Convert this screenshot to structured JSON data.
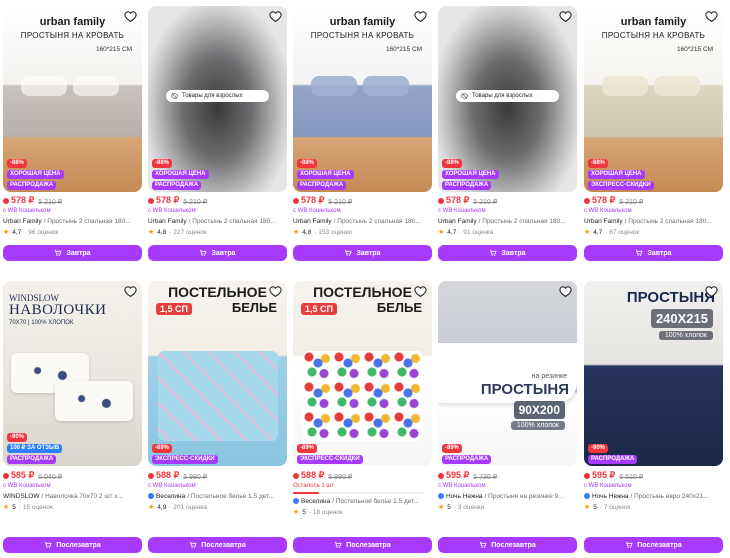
{
  "colors": {
    "accent": "#a73afd",
    "price": "#f0363c",
    "star": "#ff9900"
  },
  "adult_label": "Товары для взрослых",
  "cards": [
    {
      "image": {
        "logo": "urban family",
        "subtitle": "ПРОСТЫНЯ НА КРОВАТЬ",
        "size": "160*215 СМ"
      },
      "badges": [
        "-88%",
        "ХОРОШАЯ ЦЕНА",
        "РАСПРОДАЖА"
      ],
      "price": "578 ₽",
      "old_price": "5 210 ₽",
      "wallet": "с WB Кошельком",
      "brand": "Urban Family",
      "name": "/ Простынь 2 спальная 180...",
      "rating": "4,7",
      "reviews": "· 96 оценок",
      "button": "Завтра"
    },
    {
      "image": {},
      "badges": [
        "-88%",
        "ХОРОШАЯ ЦЕНА",
        "РАСПРОДАЖА"
      ],
      "price": "578 ₽",
      "old_price": "5 210 ₽",
      "wallet": "с WB Кошельком",
      "brand": "Urban Family",
      "name": "/ Простынь 2 спальная 180...",
      "rating": "4,8",
      "reviews": "· 227 оценок",
      "button": "Завтра"
    },
    {
      "image": {
        "logo": "urban family",
        "subtitle": "ПРОСТЫНЯ НА КРОВАТЬ",
        "size": "160*215 СМ"
      },
      "badges": [
        "-88%",
        "ХОРОШАЯ ЦЕНА",
        "РАСПРОДАЖА"
      ],
      "price": "578 ₽",
      "old_price": "5 210 ₽",
      "wallet": "с WB Кошельком",
      "brand": "Urban Family",
      "name": "/ Простынь 2 спальная 180...",
      "rating": "4,8",
      "reviews": "· 153 оценки",
      "button": "Завтра"
    },
    {
      "image": {},
      "badges": [
        "-88%",
        "ХОРОШАЯ ЦЕНА",
        "РАСПРОДАЖА"
      ],
      "price": "578 ₽",
      "old_price": "5 210 ₽",
      "wallet": "с WB Кошельком",
      "brand": "Urban Family",
      "name": "/ Простынь 2 спальная 180...",
      "rating": "4,7",
      "reviews": "· 91 оценка",
      "button": "Завтра"
    },
    {
      "image": {
        "logo": "urban family",
        "subtitle": "ПРОСТЫНЯ НА КРОВАТЬ",
        "size": "160*215 СМ"
      },
      "badges": [
        "-88%",
        "ХОРОШАЯ ЦЕНА",
        "ЭКСПРЕСС-СКИДКИ"
      ],
      "price": "578 ₽",
      "old_price": "5 210 ₽",
      "wallet": "с WB Кошельком",
      "brand": "Urban Family",
      "name": "/ Простынь 2 спальная 180...",
      "rating": "4,7",
      "reviews": "· 67 оценок",
      "button": "Завтра"
    },
    {
      "image": {
        "brand": "WINDSLOW",
        "title": "НАВОЛОЧКИ",
        "sub": "70Х70 | 100% ХЛОПОК"
      },
      "badges": [
        "-90%",
        "100 ₽ ЗА ОТЗЫВ",
        "РАСПРОДАЖА"
      ],
      "price": "585 ₽",
      "old_price": "6 040 ₽",
      "wallet": "с WB Кошельком",
      "brand": "WINDSLOW",
      "name": "/ Наволочка 70х70 2 шт х...",
      "rating": "5",
      "reviews": "· 15 оценок",
      "button": "Послезавтра"
    },
    {
      "image": {
        "title": "ПОСТЕЛЬНОЕ",
        "title2": "БЕЛЬЕ",
        "sp": "1,5 СП"
      },
      "badges": [
        "-89%",
        "ЭКСПРЕСС-СКИДКИ"
      ],
      "price": "588 ₽",
      "old_price": "5 990 ₽",
      "wallet": "с WB Кошельком",
      "brand": "Веселина",
      "name": "/ Постельное белье 1.5 дет...",
      "rating": "4,9",
      "reviews": "· 201 оценка",
      "button": "Послезавтра"
    },
    {
      "image": {
        "title": "ПОСТЕЛЬНОЕ",
        "title2": "БЕЛЬЕ",
        "sp": "1,5 СП"
      },
      "badges": [
        "-89%",
        "ЭКСПРЕСС-СКИДКИ"
      ],
      "price": "588 ₽",
      "old_price": "5 990 ₽",
      "stock": "Осталось 1 шт",
      "stock_fraction": 0.2,
      "brand": "Веселина",
      "name": "/ Постельное белье 1.5 дет...",
      "rating": "5",
      "reviews": "· 18 оценок",
      "button": "Послезавтра"
    },
    {
      "image": {
        "label": "на резинке",
        "title": "ПРОСТЫНЯ",
        "size": "90Х200",
        "cotton": "100% хлопок"
      },
      "badges": [
        "-89%",
        "РАСПРОДАЖА"
      ],
      "price": "595 ₽",
      "old_price": "5 730 ₽",
      "wallet": "с WB Кошельком",
      "brand": "Ночь Нежна",
      "name": "/ Простыня на резинке 9...",
      "rating": "5",
      "reviews": "· 3 оценки",
      "button": "Послезавтра"
    },
    {
      "image": {
        "title": "ПРОСТЫНЯ",
        "size": "240Х215",
        "cotton": "100% хлопок"
      },
      "badges": [
        "-90%",
        "РАСПРОДАЖА"
      ],
      "price": "595 ₽",
      "old_price": "6 510 ₽",
      "wallet": "с WB Кошельком",
      "brand": "Ночь Нежна",
      "name": "/ Простынь евро 240х21...",
      "rating": "5",
      "reviews": "· 7 оценок",
      "button": "Послезавтра"
    }
  ]
}
